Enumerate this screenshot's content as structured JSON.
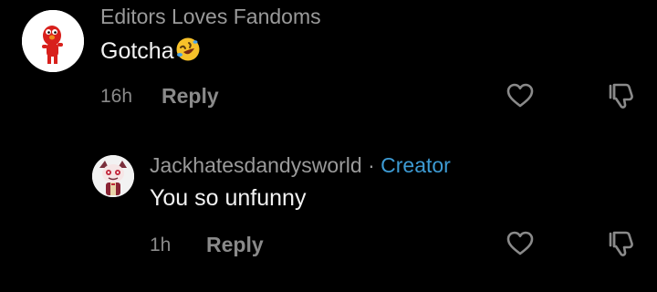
{
  "comments": [
    {
      "username": "Editors Loves Fandoms",
      "text": "Gotcha",
      "emoji": "rolling-on-floor-laughing",
      "time": "16h",
      "reply_label": "Reply"
    },
    {
      "username": "Jackhatesdandysworld",
      "separator": "·",
      "creator_label": "Creator",
      "text": "You so unfunny",
      "time": "1h",
      "reply_label": "Reply"
    }
  ],
  "colors": {
    "background": "#000000",
    "username": "#9a9a9a",
    "text": "#f2f2f2",
    "meta": "#8a8a8a",
    "creator": "#3d9bd4"
  },
  "icons": [
    "heart-icon",
    "dislike-icon"
  ]
}
